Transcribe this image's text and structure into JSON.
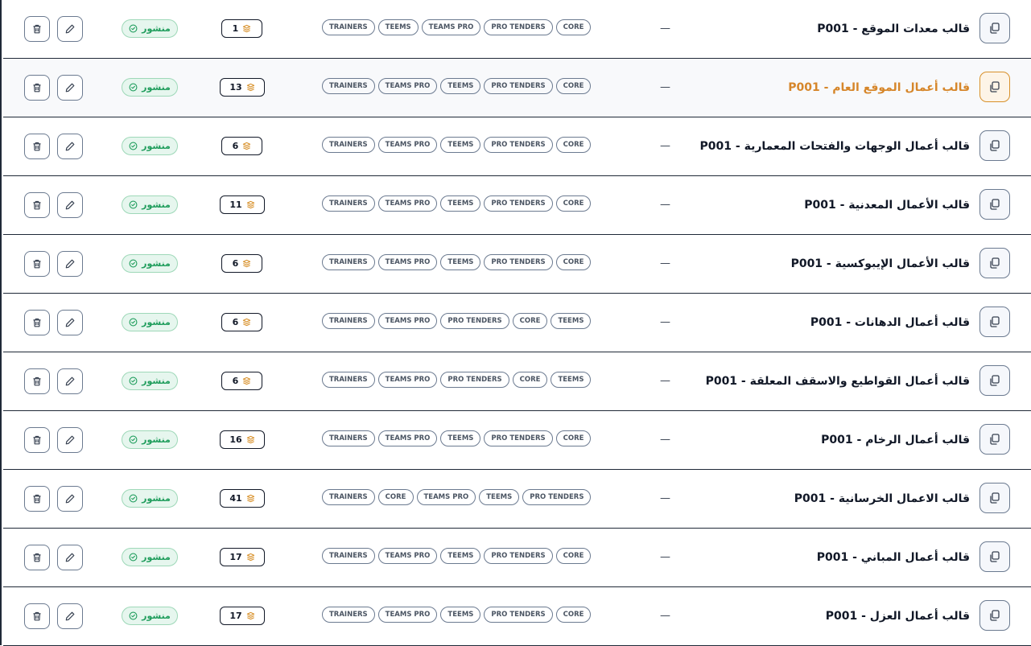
{
  "status_label": "منشور",
  "rows": [
    {
      "title": "قالب معدات الموقع - P001",
      "dash": "—",
      "tags": [
        "TRAINERS",
        "TEEMS",
        "TEAMS PRO",
        "PRO TENDERS",
        "CORE"
      ],
      "count": "1"
    },
    {
      "title": "قالب أعمال الموقع العام - P001",
      "dash": "—",
      "tags": [
        "TRAINERS",
        "TEAMS PRO",
        "TEEMS",
        "PRO TENDERS",
        "CORE"
      ],
      "count": "13",
      "highlight": true
    },
    {
      "title": "قالب أعمال الوجهات والفتحات المعمارية - P001",
      "dash": "—",
      "tags": [
        "TRAINERS",
        "TEAMS PRO",
        "TEEMS",
        "PRO TENDERS",
        "CORE"
      ],
      "count": "6"
    },
    {
      "title": "قالب الأعمال المعدنية - P001",
      "dash": "—",
      "tags": [
        "TRAINERS",
        "TEAMS PRO",
        "TEEMS",
        "PRO TENDERS",
        "CORE"
      ],
      "count": "11"
    },
    {
      "title": "قالب الأعمال الإيبوكسية - P001",
      "dash": "—",
      "tags": [
        "TRAINERS",
        "TEAMS PRO",
        "TEEMS",
        "PRO TENDERS",
        "CORE"
      ],
      "count": "6"
    },
    {
      "title": "قالب أعمال الدهانات - P001",
      "dash": "—",
      "tags": [
        "TRAINERS",
        "TEAMS PRO",
        "PRO TENDERS",
        "CORE",
        "TEEMS"
      ],
      "count": "6"
    },
    {
      "title": "قالب أعمال القواطيع والاسقف المعلقة - P001",
      "dash": "—",
      "tags": [
        "TRAINERS",
        "TEAMS PRO",
        "PRO TENDERS",
        "CORE",
        "TEEMS"
      ],
      "count": "6"
    },
    {
      "title": "قالب أعمال الرخام - P001",
      "dash": "—",
      "tags": [
        "TRAINERS",
        "TEAMS PRO",
        "TEEMS",
        "PRO TENDERS",
        "CORE"
      ],
      "count": "16"
    },
    {
      "title": "قالب الاعمال الخرسانية - P001",
      "dash": "—",
      "tags": [
        "TRAINERS",
        "CORE",
        "TEAMS PRO",
        "TEEMS",
        "PRO TENDERS"
      ],
      "count": "41"
    },
    {
      "title": "قالب أعمال المباني - P001",
      "dash": "—",
      "tags": [
        "TRAINERS",
        "TEAMS PRO",
        "TEEMS",
        "PRO TENDERS",
        "CORE"
      ],
      "count": "17"
    },
    {
      "title": "قالب أعمال العزل - P001",
      "dash": "—",
      "tags": [
        "TRAINERS",
        "TEAMS PRO",
        "TEEMS",
        "PRO TENDERS",
        "CORE"
      ],
      "count": "17"
    }
  ],
  "colors": {
    "accent": "#d6862a",
    "status_green": "#1f9d5c",
    "status_bg": "#e6f6ee",
    "border": "#1f2937"
  },
  "icons": {
    "copy": "copy-icon",
    "count": "layers-icon",
    "status": "check-circle-icon",
    "edit": "pencil-icon",
    "delete": "trash-icon"
  }
}
